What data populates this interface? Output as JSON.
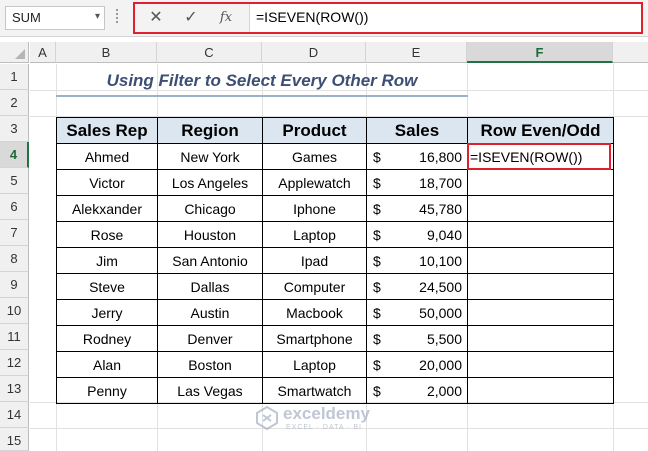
{
  "formula_bar": {
    "name_box": "SUM",
    "name_box_arrow": "▾",
    "cancel_icon": "✕",
    "enter_icon": "✓",
    "function_icon": "fx",
    "formula": "=ISEVEN(ROW())"
  },
  "columns": [
    "A",
    "B",
    "C",
    "D",
    "E",
    "F"
  ],
  "rows": [
    "1",
    "2",
    "3",
    "4",
    "5",
    "6",
    "7",
    "8",
    "9",
    "10",
    "11",
    "12",
    "13",
    "14",
    "15"
  ],
  "active_cell": {
    "column": "F",
    "row": "4"
  },
  "title": "Using Filter to Select Every Other Row",
  "table": {
    "headers": [
      "Sales Rep",
      "Region",
      "Product",
      "Sales",
      "Row Even/Odd"
    ],
    "currency_symbol": "$",
    "rows": [
      [
        "Ahmed",
        "New York",
        "Games",
        "16,800",
        "=ISEVEN(ROW())"
      ],
      [
        "Victor",
        "Los Angeles",
        "Applewatch",
        "18,700",
        ""
      ],
      [
        "Alekxander",
        "Chicago",
        "Iphone",
        "45,780",
        ""
      ],
      [
        "Rose",
        "Houston",
        "Laptop",
        "9,040",
        ""
      ],
      [
        "Jim",
        "San Antonio",
        "Ipad",
        "10,100",
        ""
      ],
      [
        "Steve",
        "Dallas",
        "Computer",
        "24,500",
        ""
      ],
      [
        "Jerry",
        "Austin",
        "Macbook",
        "50,000",
        ""
      ],
      [
        "Rodney",
        "Denver",
        "Smartphone",
        "5,500",
        ""
      ],
      [
        "Alan",
        "Boston",
        "Laptop",
        "20,000",
        ""
      ],
      [
        "Penny",
        "Las Vegas",
        "Smartwatch",
        "2,000",
        ""
      ]
    ]
  },
  "watermark": {
    "name": "exceldemy",
    "tagline": "EXCEL · DATA · BI"
  },
  "colors": {
    "highlight": "#e0202c",
    "header_fill": "#dce6f1",
    "title": "#3d4f72",
    "active_header": "#217346"
  }
}
